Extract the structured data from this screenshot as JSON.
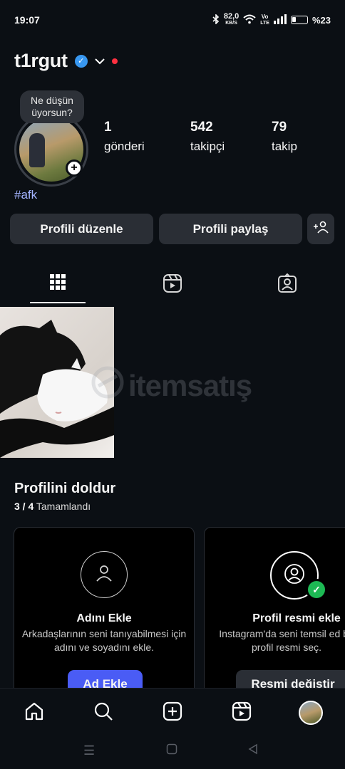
{
  "status_bar": {
    "time": "19:07",
    "speed_value": "82,0",
    "speed_unit": "KB/S",
    "network_top": "Vo",
    "network_bottom": "LTE",
    "battery": "%23"
  },
  "header": {
    "username": "t1rgut"
  },
  "profile": {
    "note": "Ne düşün üyorsun?",
    "stats": [
      {
        "value": "1",
        "label": "gönderi"
      },
      {
        "value": "542",
        "label": "takipçi"
      },
      {
        "value": "79",
        "label": "takip"
      }
    ],
    "hashtag": "#afk",
    "edit_button": "Profili düzenle",
    "share_button": "Profili paylaş"
  },
  "tabs": [
    {
      "icon": "grid-icon"
    },
    {
      "icon": "reels-icon"
    },
    {
      "icon": "tagged-icon"
    }
  ],
  "watermark": "itemsatış",
  "fill_profile": {
    "title": "Profilini doldur",
    "progress_count": "3 / 4",
    "progress_label": "Tamamlandı",
    "cards": [
      {
        "title": "Adını Ekle",
        "description": "Arkadaşlarının seni tanıyabilmesi için adını ve soyadını ekle.",
        "button": "Ad Ekle",
        "button_color": "#4a5cf5"
      },
      {
        "title": "Profil resmi ekle",
        "description": "Instagram'da seni temsil ed bir profil resmi seç.",
        "button": "Resmi değiştir",
        "button_color": "#2a2e35"
      }
    ]
  },
  "bottom_nav": [
    {
      "icon": "home-icon"
    },
    {
      "icon": "search-icon"
    },
    {
      "icon": "create-icon"
    },
    {
      "icon": "reels-icon"
    },
    {
      "icon": "profile-avatar"
    }
  ],
  "colors": {
    "background": "#0b0f14",
    "button": "#2a2e35",
    "primary": "#4a5cf5",
    "verified": "#3897f0",
    "hashtag": "#a4b4ff"
  }
}
